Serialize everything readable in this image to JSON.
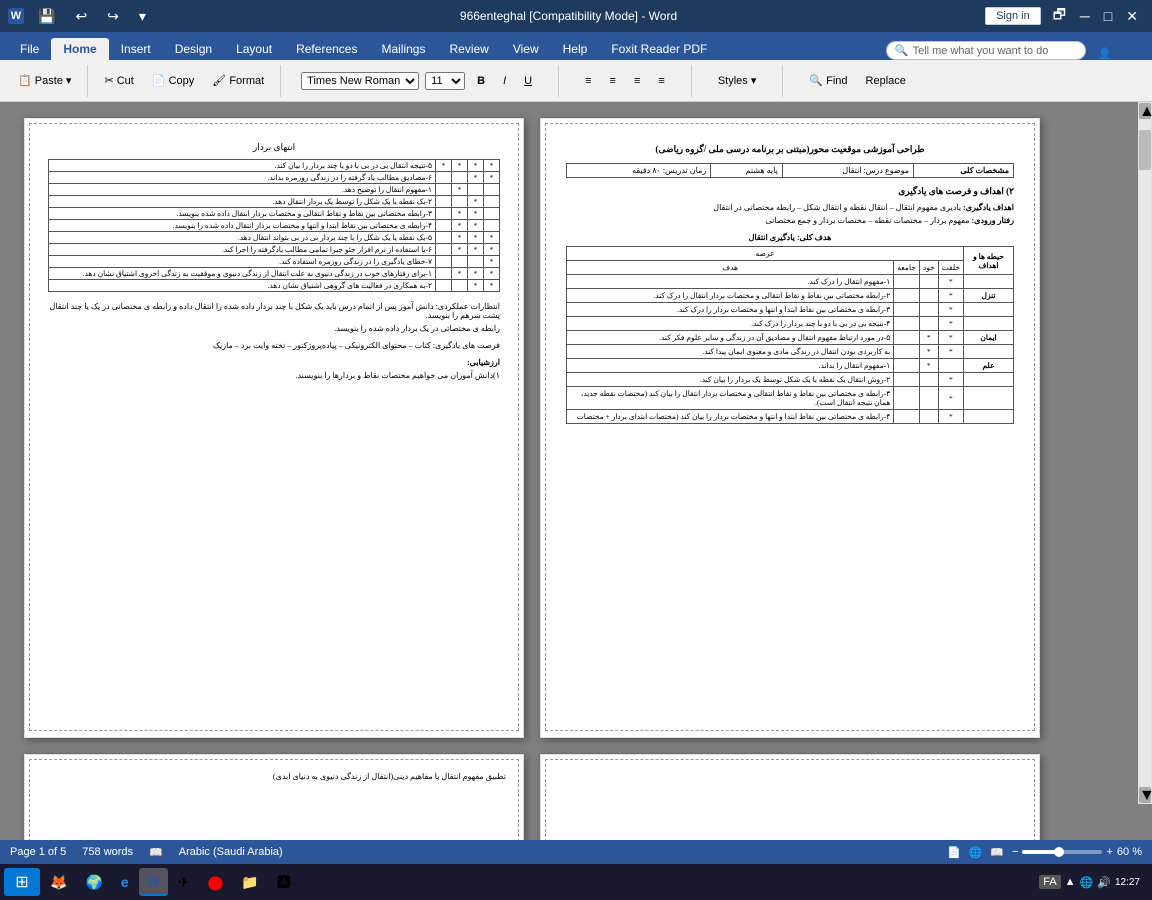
{
  "titlebar": {
    "title": "966enteghal [Compatibility Mode] - Word",
    "sign_in": "Sign in"
  },
  "ribbon": {
    "tabs": [
      "File",
      "Home",
      "Insert",
      "Design",
      "Layout",
      "References",
      "Mailings",
      "Review",
      "View",
      "Help",
      "Foxit Reader PDF"
    ],
    "active_tab": "Home",
    "tell_me": "Tell me what you want to do",
    "share": "Share"
  },
  "statusbar": {
    "page_info": "Page 1 of 5",
    "words": "758 words",
    "language": "Arabic (Saudi Arabia)",
    "zoom": "60 %"
  },
  "taskbar": {
    "time": "12:27",
    "lang": "FA"
  },
  "page1_left": {
    "title": "انتهای بردار",
    "rows": [
      {
        "star1": "*",
        "star2": "*",
        "star3": "*",
        "star4": "*",
        "text": "۵-نتیجه انتقال بی در بی با دو یا چند بردار را بیان کند."
      },
      {
        "star1": "*",
        "star2": "*",
        "star3": "",
        "star4": "",
        "text": "۶-مصادیق مطالب یاد گرفته را در زندگی روزمره بداند."
      },
      {
        "star1": "",
        "star2": "",
        "star3": "*",
        "star4": "",
        "text": "۱-مفهوم انتقال را توضیح دهد."
      },
      {
        "star1": "",
        "star2": "*",
        "star3": "",
        "star4": "",
        "text": "۲-یک نقطه یا یک شکل را توسط یک بردار انتقال دهد."
      },
      {
        "star1": "",
        "star2": "*",
        "star3": "*",
        "star4": "",
        "text": "۳-رابطه مختصاتی بین نقاط و تقاط انتقالی و مختصات بردار انتقال داده شده بنویسد."
      },
      {
        "star1": "",
        "star2": "*",
        "star3": "*",
        "star4": "",
        "text": "۴-رابطه ی مختصاتی بین نقاط ابتدا و انتها و مختصات بردار انتقال داده شده را بنویسد."
      },
      {
        "star1": "*",
        "star2": "*",
        "star3": "*",
        "star4": "",
        "text": "۵-یک نقطه یا یک شکل را با چند بردار بی در بی بتواند انتقال دهد."
      },
      {
        "star1": "*",
        "star2": "*",
        "star3": "*",
        "star4": "",
        "text": "۶-با استفاده از نرم افزار جئو جبرا تمامی مطالب یادگرفته را اجرا کند."
      },
      {
        "star1": "*",
        "star2": "",
        "star3": "",
        "star4": "",
        "text": "۷-خطای یادگیری را در زندگی روزمره استفاده کند."
      }
    ]
  },
  "page1_right": {
    "header": "طراحی آموزشی موقعیت محور(مبتنی بر برنامه درسی ملی /گروه ریاضی)",
    "cols": [
      "مشخصات کلی",
      "موضوع درس: انتقال",
      "پایه هشتم",
      "زمان تدریس: ۸۰ دقیقه"
    ],
    "section2_title": "۲) اهداف و فرصت های یادگیری",
    "ahdaf_yadgiri": "اهداف یادگیری: یادیری مفهوم انتقال – انتقال نقطه و انتقال شکل – رابطه مختصاتی در انتقال",
    "raftare_vorudi": "رفتار ورودی: مفهوم بردار – مختصات نقطه – مختصات بردار و جمع مختصاتی",
    "table_title": "هدف کلی: یادگیری انتقال"
  },
  "icons": {
    "save": "💾",
    "undo": "↩",
    "redo": "↪",
    "search": "🔍",
    "share": "👤",
    "windows": "⊞",
    "firefox": "🦊",
    "chrome": "◉",
    "word": "W",
    "telegram": "✈",
    "settings": "⚙"
  }
}
